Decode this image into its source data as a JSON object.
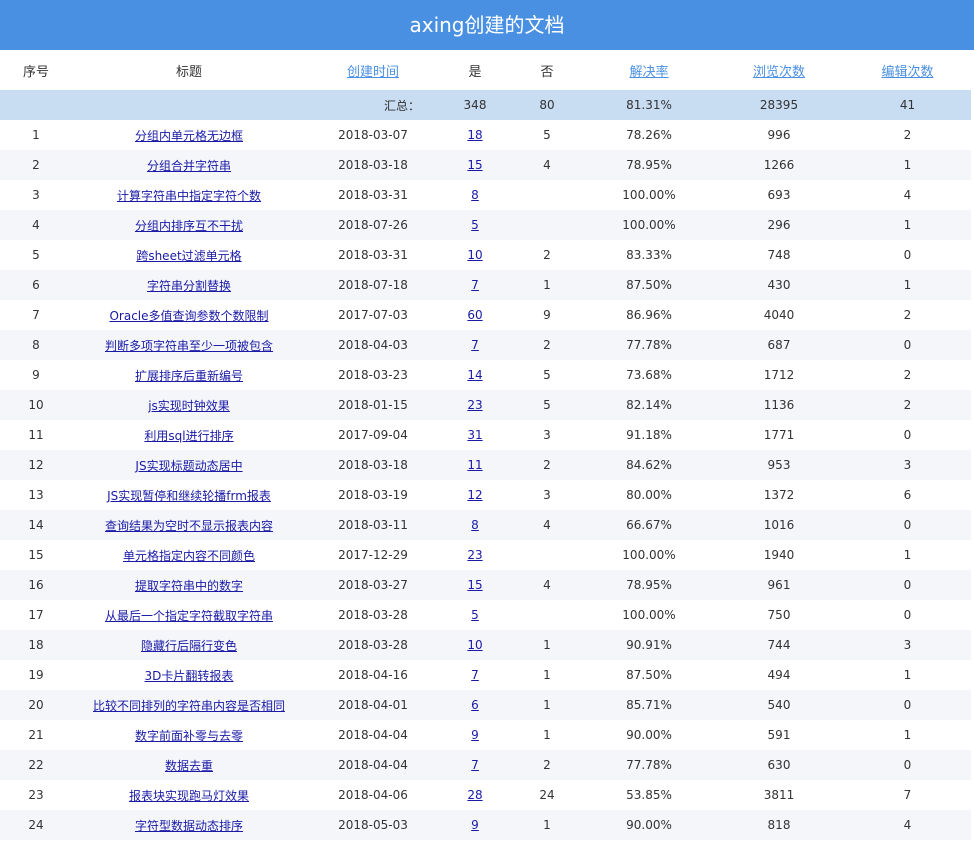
{
  "header": {
    "title": "axing创建的文档"
  },
  "columns": [
    "序号",
    "标题",
    "创建时间",
    "是",
    "否",
    "解决率",
    "浏览次数",
    "编辑次数"
  ],
  "summary": {
    "label": "汇总：",
    "yes": "348",
    "no": "80",
    "rate": "81.31%",
    "views": "28395",
    "edits": "41"
  },
  "rows": [
    {
      "seq": "1",
      "title": "分组内单元格无边框",
      "date": "2018-03-07",
      "yes": "18",
      "no": "5",
      "rate": "78.26%",
      "views": "996",
      "edits": "2"
    },
    {
      "seq": "2",
      "title": "分组合并字符串",
      "date": "2018-03-18",
      "yes": "15",
      "no": "4",
      "rate": "78.95%",
      "views": "1266",
      "edits": "1"
    },
    {
      "seq": "3",
      "title": "计算字符串中指定字符个数",
      "date": "2018-03-31",
      "yes": "8",
      "no": "",
      "rate": "100.00%",
      "views": "693",
      "edits": "4"
    },
    {
      "seq": "4",
      "title": "分组内排序互不干扰",
      "date": "2018-07-26",
      "yes": "5",
      "no": "",
      "rate": "100.00%",
      "views": "296",
      "edits": "1"
    },
    {
      "seq": "5",
      "title": "跨sheet过滤单元格",
      "date": "2018-03-31",
      "yes": "10",
      "no": "2",
      "rate": "83.33%",
      "views": "748",
      "edits": "0"
    },
    {
      "seq": "6",
      "title": "字符串分割替换",
      "date": "2018-07-18",
      "yes": "7",
      "no": "1",
      "rate": "87.50%",
      "views": "430",
      "edits": "1"
    },
    {
      "seq": "7",
      "title": "Oracle多值查询参数个数限制",
      "date": "2017-07-03",
      "yes": "60",
      "no": "9",
      "rate": "86.96%",
      "views": "4040",
      "edits": "2"
    },
    {
      "seq": "8",
      "title": "判断多项字符串至少一项被包含",
      "date": "2018-04-03",
      "yes": "7",
      "no": "2",
      "rate": "77.78%",
      "views": "687",
      "edits": "0"
    },
    {
      "seq": "9",
      "title": "扩展排序后重新编号",
      "date": "2018-03-23",
      "yes": "14",
      "no": "5",
      "rate": "73.68%",
      "views": "1712",
      "edits": "2"
    },
    {
      "seq": "10",
      "title": "js实现时钟效果",
      "date": "2018-01-15",
      "yes": "23",
      "no": "5",
      "rate": "82.14%",
      "views": "1136",
      "edits": "2"
    },
    {
      "seq": "11",
      "title": "利用sql进行排序",
      "date": "2017-09-04",
      "yes": "31",
      "no": "3",
      "rate": "91.18%",
      "views": "1771",
      "edits": "0"
    },
    {
      "seq": "12",
      "title": "JS实现标题动态居中",
      "date": "2018-03-18",
      "yes": "11",
      "no": "2",
      "rate": "84.62%",
      "views": "953",
      "edits": "3"
    },
    {
      "seq": "13",
      "title": "JS实现暂停和继续轮播frm报表",
      "date": "2018-03-19",
      "yes": "12",
      "no": "3",
      "rate": "80.00%",
      "views": "1372",
      "edits": "6"
    },
    {
      "seq": "14",
      "title": "查询结果为空时不显示报表内容",
      "date": "2018-03-11",
      "yes": "8",
      "no": "4",
      "rate": "66.67%",
      "views": "1016",
      "edits": "0"
    },
    {
      "seq": "15",
      "title": "单元格指定内容不同颜色",
      "date": "2017-12-29",
      "yes": "23",
      "no": "",
      "rate": "100.00%",
      "views": "1940",
      "edits": "1"
    },
    {
      "seq": "16",
      "title": "提取字符串中的数字",
      "date": "2018-03-27",
      "yes": "15",
      "no": "4",
      "rate": "78.95%",
      "views": "961",
      "edits": "0"
    },
    {
      "seq": "17",
      "title": "从最后一个指定字符截取字符串",
      "date": "2018-03-28",
      "yes": "5",
      "no": "",
      "rate": "100.00%",
      "views": "750",
      "edits": "0"
    },
    {
      "seq": "18",
      "title": "隐藏行后隔行变色",
      "date": "2018-03-28",
      "yes": "10",
      "no": "1",
      "rate": "90.91%",
      "views": "744",
      "edits": "3"
    },
    {
      "seq": "19",
      "title": "3D卡片翻转报表",
      "date": "2018-04-16",
      "yes": "7",
      "no": "1",
      "rate": "87.50%",
      "views": "494",
      "edits": "1"
    },
    {
      "seq": "20",
      "title": "比较不同排列的字符串内容是否相同",
      "date": "2018-04-01",
      "yes": "6",
      "no": "1",
      "rate": "85.71%",
      "views": "540",
      "edits": "0"
    },
    {
      "seq": "21",
      "title": "数字前面补零与去零",
      "date": "2018-04-04",
      "yes": "9",
      "no": "1",
      "rate": "90.00%",
      "views": "591",
      "edits": "1"
    },
    {
      "seq": "22",
      "title": "数据去重",
      "date": "2018-04-04",
      "yes": "7",
      "no": "2",
      "rate": "77.78%",
      "views": "630",
      "edits": "0"
    },
    {
      "seq": "23",
      "title": "报表块实现跑马灯效果",
      "date": "2018-04-06",
      "yes": "28",
      "no": "24",
      "rate": "53.85%",
      "views": "3811",
      "edits": "7"
    },
    {
      "seq": "24",
      "title": "字符型数据动态排序",
      "date": "2018-05-03",
      "yes": "9",
      "no": "1",
      "rate": "90.00%",
      "views": "818",
      "edits": "4"
    }
  ]
}
